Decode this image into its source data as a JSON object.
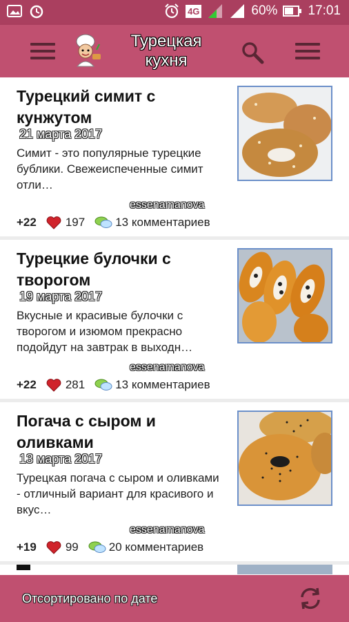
{
  "status": {
    "network": "4G",
    "battery": "60%",
    "time": "17:01"
  },
  "app": {
    "title": "Турецкая кухня"
  },
  "posts": [
    {
      "title": "Турецкий симит с кунжутом",
      "date": "21 марта 2017",
      "description": "Симит - это популярные турецкие бублики. Свежеиспеченные симит отли…",
      "author": "essenamanova",
      "score": "+22",
      "likes": "197",
      "comments": "13 комментариев",
      "image": "simit-photo"
    },
    {
      "title": "Турецкие булочки с творогом",
      "date": "19 марта 2017",
      "description": "Вкусные и красивые булочки с творогом и изюмом прекрасно подойдут на завтрак в выходн…",
      "author": "essenamanova",
      "score": "+22",
      "likes": "281",
      "comments": "13 комментариев",
      "image": "buns-photo"
    },
    {
      "title": "Погача с сыром и оливками",
      "date": "13 марта 2017",
      "description": "Турецкая погача с сыром и оливками - отличный вариант для красивого и вкус…",
      "author": "essenamanova",
      "score": "+19",
      "likes": "99",
      "comments": "20 комментариев",
      "image": "pogacha-photo"
    }
  ],
  "footer": {
    "sort_label": "Отсортировано по дате"
  },
  "colors": {
    "status_bar": "#aa3f5f",
    "app_bar": "#c05070",
    "heart": "#d0232b"
  }
}
